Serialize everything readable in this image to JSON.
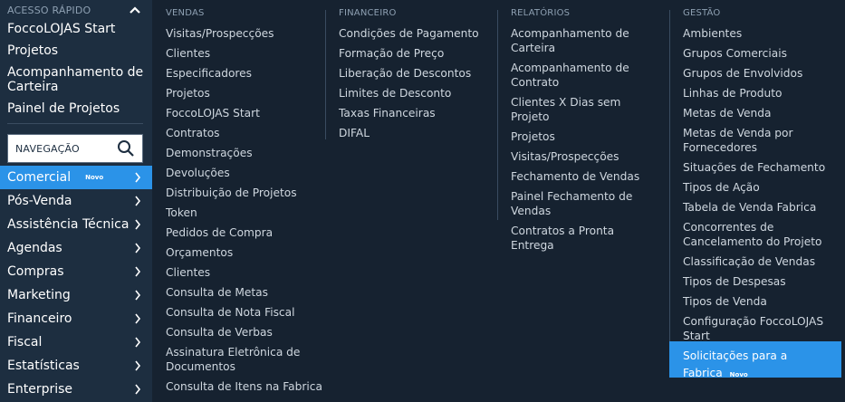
{
  "quick_access": {
    "title": "ACESSO RÁPIDO",
    "items": [
      "FoccoLOJAS Start",
      "Projetos",
      "Acompanhamento de Carteira",
      "Painel de Projetos"
    ]
  },
  "navigation_search": {
    "label": "NAVEGAÇÃO"
  },
  "nav": [
    {
      "label": "Comercial",
      "badge": "Novo",
      "active": true
    },
    {
      "label": "Pós-Venda"
    },
    {
      "label": "Assistência Técnica"
    },
    {
      "label": "Agendas"
    },
    {
      "label": "Compras"
    },
    {
      "label": "Marketing"
    },
    {
      "label": "Financeiro"
    },
    {
      "label": "Fiscal"
    },
    {
      "label": "Estatísticas"
    },
    {
      "label": "Enterprise"
    }
  ],
  "columns": [
    {
      "title": "VENDAS",
      "items": [
        "Visitas/Prospecções",
        "Clientes",
        "Especificadores",
        "Projetos",
        "FoccoLOJAS Start",
        "Contratos",
        "Demonstrações",
        "Devoluções",
        "Distribuição de Projetos",
        "Token",
        "Pedidos de Compra",
        "Orçamentos",
        "Clientes",
        "Consulta de Metas",
        "Consulta de Nota Fiscal",
        "Consulta de Verbas",
        "Assinatura Eletrônica de Documentos",
        "Consulta de Itens na Fabrica"
      ]
    },
    {
      "title": "FINANCEIRO",
      "items": [
        "Condições de Pagamento",
        "Formação de Preço",
        "Liberação de Descontos",
        "Limites de Desconto",
        "Taxas Financeiras",
        "DIFAL"
      ]
    },
    {
      "title": "RELATÓRIOS",
      "items": [
        "Acompanhamento de Carteira",
        "Acompanhamento de Contrato",
        "Clientes X Dias sem Projeto",
        "Projetos",
        "Visitas/Prospecções",
        "Fechamento de Vendas",
        "Painel Fechamento de Vendas",
        "Contratos a Pronta Entrega"
      ]
    },
    {
      "title": "GESTÃO",
      "items": [
        "Ambientes",
        "Grupos Comerciais",
        "Grupos de Envolvidos",
        "Linhas de Produto",
        "Metas de Venda",
        "Metas de Venda por Fornecedores",
        "Situações de Fechamento",
        "Tipos de Ação",
        "Tabela de Venda Fabrica",
        "Concorrentes de Cancelamento do Projeto",
        "Classificação de Vendas",
        "Tipos de Despesas",
        "Tipos de Venda",
        "Configuração FoccoLOJAS Start"
      ],
      "highlighted": {
        "label": "Solicitações para a Fabrica",
        "badge": "Novo"
      }
    }
  ],
  "colors": {
    "sidebar_bg": "#1d2e40",
    "main_bg": "#162230",
    "accent": "#2b93e8"
  }
}
